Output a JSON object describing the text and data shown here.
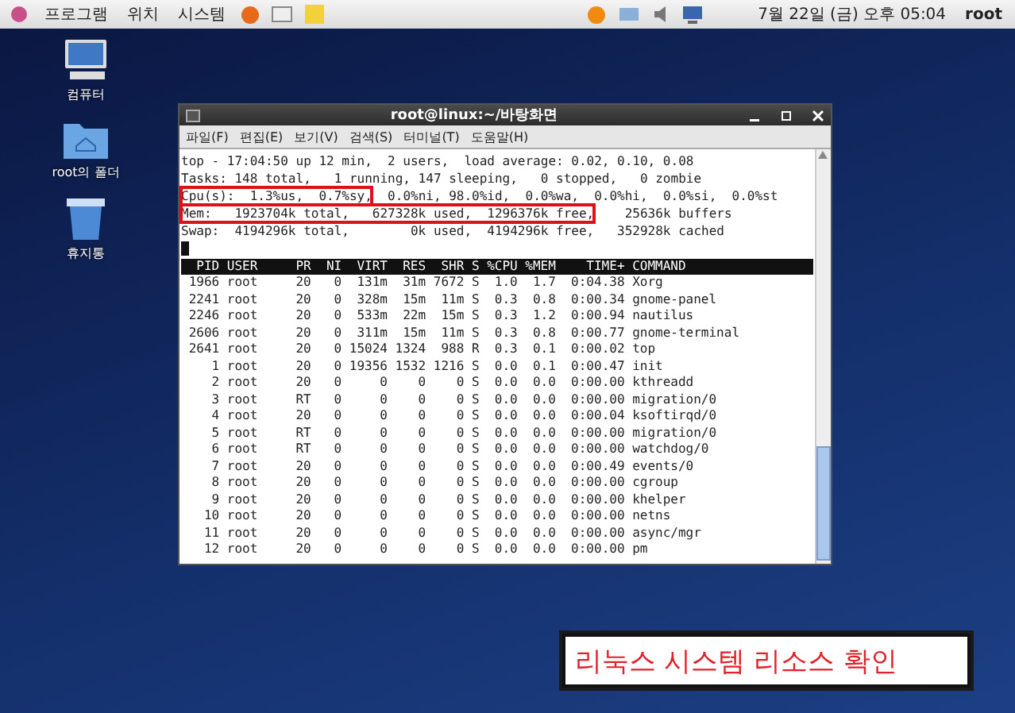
{
  "panel": {
    "menus": [
      "프로그램",
      "위치",
      "시스템"
    ],
    "clock": "7월 22일 (금) 오후 05:04",
    "user": "root"
  },
  "desktop_icons": [
    {
      "kind": "computer",
      "label": "컴퓨터"
    },
    {
      "kind": "folder",
      "label": "root의 폴더"
    },
    {
      "kind": "trash",
      "label": "휴지통"
    }
  ],
  "window": {
    "title": "root@linux:~/바탕화면",
    "menu": [
      "파일(F)",
      "편집(E)",
      "보기(V)",
      "검색(S)",
      "터미널(T)",
      "도움말(H)"
    ]
  },
  "summary": [
    [
      {
        "text": "top - 17:04:50 up 12 min,  2 users,  load average: 0.02, 0.10, 0.08",
        "highlighted": false
      }
    ],
    [
      {
        "text": "Tasks: 148 total,   1 running, 147 sleeping,   0 stopped,   0 zombie",
        "highlighted": false
      }
    ],
    [
      {
        "text": "Cpu(s):  1.3%us,  0.7%sy,",
        "highlighted": true
      },
      {
        "text": "  0.0%ni, 98.0%id,  0.0%wa,  0.0%hi,  0.0%si,  0.0%st",
        "highlighted": false
      }
    ],
    [
      {
        "text": "Mem:   1923704k total,   627328k used,  1296376k free,",
        "highlighted": true
      },
      {
        "text": "    25636k buffers",
        "highlighted": false
      }
    ],
    [
      {
        "text": "Swap:  4194296k total,        0k used,  4194296k free,   352928k cached",
        "highlighted": false
      }
    ]
  ],
  "table": {
    "columns": [
      "PID",
      "USER",
      "PR",
      "NI",
      "VIRT",
      "RES",
      "SHR",
      "S",
      "%CPU",
      "%MEM",
      "TIME+",
      "COMMAND"
    ],
    "rows": [
      [
        "1966",
        "root",
        "20",
        "0",
        "131m",
        "31m",
        "7672",
        "S",
        "1.0",
        "1.7",
        "0:04.38",
        "Xorg"
      ],
      [
        "2241",
        "root",
        "20",
        "0",
        "328m",
        "15m",
        "11m",
        "S",
        "0.3",
        "0.8",
        "0:00.34",
        "gnome-panel"
      ],
      [
        "2246",
        "root",
        "20",
        "0",
        "533m",
        "22m",
        "15m",
        "S",
        "0.3",
        "1.2",
        "0:00.94",
        "nautilus"
      ],
      [
        "2606",
        "root",
        "20",
        "0",
        "311m",
        "15m",
        "11m",
        "S",
        "0.3",
        "0.8",
        "0:00.77",
        "gnome-terminal"
      ],
      [
        "2641",
        "root",
        "20",
        "0",
        "15024",
        "1324",
        "988",
        "R",
        "0.3",
        "0.1",
        "0:00.02",
        "top"
      ],
      [
        "1",
        "root",
        "20",
        "0",
        "19356",
        "1532",
        "1216",
        "S",
        "0.0",
        "0.1",
        "0:00.47",
        "init"
      ],
      [
        "2",
        "root",
        "20",
        "0",
        "0",
        "0",
        "0",
        "S",
        "0.0",
        "0.0",
        "0:00.00",
        "kthreadd"
      ],
      [
        "3",
        "root",
        "RT",
        "0",
        "0",
        "0",
        "0",
        "S",
        "0.0",
        "0.0",
        "0:00.00",
        "migration/0"
      ],
      [
        "4",
        "root",
        "20",
        "0",
        "0",
        "0",
        "0",
        "S",
        "0.0",
        "0.0",
        "0:00.04",
        "ksoftirqd/0"
      ],
      [
        "5",
        "root",
        "RT",
        "0",
        "0",
        "0",
        "0",
        "S",
        "0.0",
        "0.0",
        "0:00.00",
        "migration/0"
      ],
      [
        "6",
        "root",
        "RT",
        "0",
        "0",
        "0",
        "0",
        "S",
        "0.0",
        "0.0",
        "0:00.00",
        "watchdog/0"
      ],
      [
        "7",
        "root",
        "20",
        "0",
        "0",
        "0",
        "0",
        "S",
        "0.0",
        "0.0",
        "0:00.49",
        "events/0"
      ],
      [
        "8",
        "root",
        "20",
        "0",
        "0",
        "0",
        "0",
        "S",
        "0.0",
        "0.0",
        "0:00.00",
        "cgroup"
      ],
      [
        "9",
        "root",
        "20",
        "0",
        "0",
        "0",
        "0",
        "S",
        "0.0",
        "0.0",
        "0:00.00",
        "khelper"
      ],
      [
        "10",
        "root",
        "20",
        "0",
        "0",
        "0",
        "0",
        "S",
        "0.0",
        "0.0",
        "0:00.00",
        "netns"
      ],
      [
        "11",
        "root",
        "20",
        "0",
        "0",
        "0",
        "0",
        "S",
        "0.0",
        "0.0",
        "0:00.00",
        "async/mgr"
      ],
      [
        "12",
        "root",
        "20",
        "0",
        "0",
        "0",
        "0",
        "S",
        "0.0",
        "0.0",
        "0:00.00",
        "pm"
      ]
    ]
  },
  "caption": "리눅스 시스템 리소스 확인"
}
